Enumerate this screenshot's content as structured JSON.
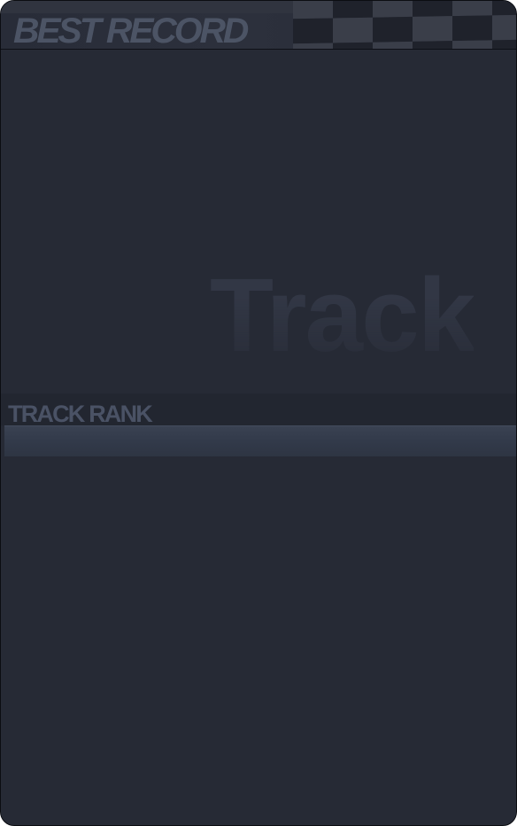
{
  "header": {
    "title": "BEST RECORD"
  },
  "watermark": {
    "text": "Track"
  },
  "rank": {
    "label": "TRACK RANK"
  },
  "colors": {
    "panel_bg": "#262a35",
    "title_text": "#4c5465",
    "rank_bar": "#353d4d",
    "checker_dark": "#1f222b",
    "checker_light": "#3a3e49"
  }
}
